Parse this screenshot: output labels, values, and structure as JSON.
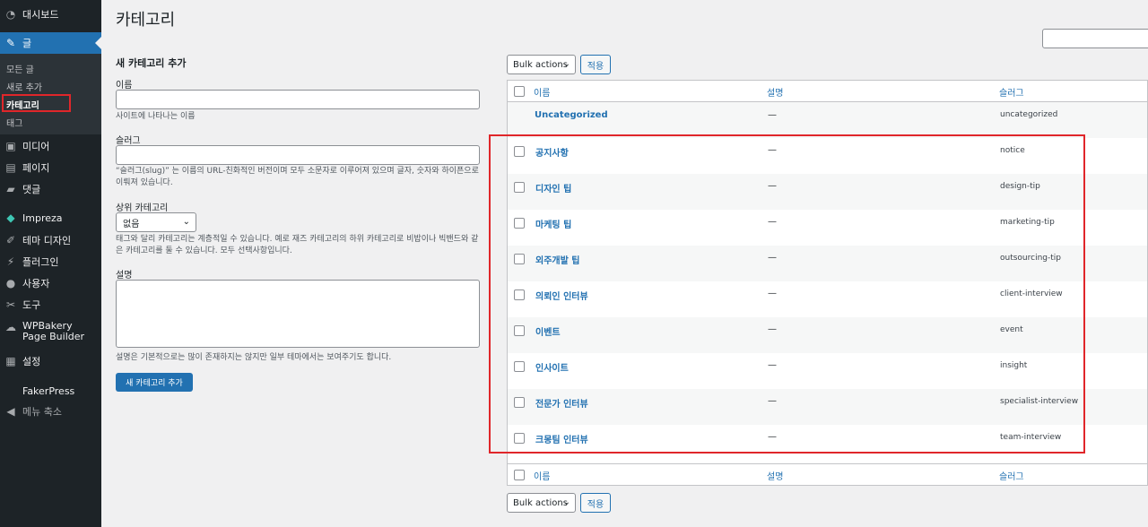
{
  "sidebar": {
    "items": [
      {
        "key": "dashboard",
        "label": "대시보드",
        "icon": "dashboard-icon",
        "glyph": "◔"
      },
      {
        "key": "posts",
        "label": "글",
        "icon": "pin-icon",
        "glyph": "✎"
      },
      {
        "key": "media",
        "label": "미디어",
        "icon": "media-icon",
        "glyph": "▣"
      },
      {
        "key": "pages",
        "label": "페이지",
        "icon": "pages-icon",
        "glyph": "▤"
      },
      {
        "key": "comments",
        "label": "댓글",
        "icon": "comments-icon",
        "glyph": "▰"
      },
      {
        "key": "impreza",
        "label": "Impreza",
        "icon": "diamond-icon",
        "glyph": "◆"
      },
      {
        "key": "theme-design",
        "label": "테마 디자인",
        "icon": "brush-icon",
        "glyph": "✐"
      },
      {
        "key": "plugins",
        "label": "플러그인",
        "icon": "plugin-icon",
        "glyph": "⚡"
      },
      {
        "key": "users",
        "label": "사용자",
        "icon": "user-icon",
        "glyph": "●"
      },
      {
        "key": "tools",
        "label": "도구",
        "icon": "wrench-icon",
        "glyph": "✂"
      },
      {
        "key": "wpbakery",
        "label": "WPBakery Page Builder",
        "icon": "cloud-icon",
        "glyph": "☁"
      },
      {
        "key": "settings",
        "label": "설정",
        "icon": "settings-icon",
        "glyph": "▦"
      },
      {
        "key": "fakerpress",
        "label": "FakerPress",
        "icon": "",
        "glyph": ""
      },
      {
        "key": "collapse",
        "label": "메뉴 축소",
        "icon": "collapse-icon",
        "glyph": "◀"
      }
    ],
    "submenu": {
      "all_posts": "모든 글",
      "add_new": "새로 추가",
      "categories": "카테고리",
      "tags": "태그"
    }
  },
  "page_title": "카테고리",
  "form": {
    "heading": "새 카테고리 추가",
    "name_label": "이름",
    "name_value": "",
    "name_help": "사이트에 나타나는 이름",
    "slug_label": "슬러그",
    "slug_value": "",
    "slug_help": "“슬러그(slug)” 는 이름의 URL-친화적인 버전이며 모두 소문자로 이루어져 있으며 글자, 숫자와 하이픈으로 이뤄져 있습니다.",
    "parent_label": "상위 카테고리",
    "parent_value": "없음",
    "parent_help": "태그와 달리 카테고리는 계층적일 수 있습니다. 예로 재즈 카테고리의 하위 카테고리로 비밥이나 빅밴드와 같은 카테고리를 둘 수 있습니다. 모두 선택사항입니다.",
    "desc_label": "설명",
    "desc_value": "",
    "desc_help": "설명은 기본적으로는 많이 존재하지는 않지만 일부 테마에서는 보여주기도 합니다.",
    "submit_label": "새 카테고리 추가"
  },
  "table": {
    "bulk_label": "Bulk actions",
    "apply_label": "적용",
    "columns": {
      "name": "이름",
      "description": "설명",
      "slug": "슬러그"
    },
    "rows": [
      {
        "name": "Uncategorized",
        "description": "—",
        "slug": "uncategorized"
      },
      {
        "name": "공지사항",
        "description": "—",
        "slug": "notice"
      },
      {
        "name": "디자인 팁",
        "description": "—",
        "slug": "design-tip"
      },
      {
        "name": "마케팅 팁",
        "description": "—",
        "slug": "marketing-tip"
      },
      {
        "name": "외주개발 팁",
        "description": "—",
        "slug": "outsourcing-tip"
      },
      {
        "name": "의뢰인 인터뷰",
        "description": "—",
        "slug": "client-interview"
      },
      {
        "name": "이벤트",
        "description": "—",
        "slug": "event"
      },
      {
        "name": "인사이트",
        "description": "—",
        "slug": "insight"
      },
      {
        "name": "전문가 인터뷰",
        "description": "—",
        "slug": "specialist-interview"
      },
      {
        "name": "크몽팀 인터뷰",
        "description": "—",
        "slug": "team-interview"
      }
    ]
  },
  "colors": {
    "sidebar_bg": "#1d2327",
    "accent": "#2271b1",
    "highlight": "#e0262a"
  }
}
